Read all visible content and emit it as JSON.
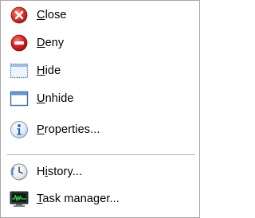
{
  "menu": {
    "items": [
      {
        "id": "close",
        "label": "Close",
        "mnemonic_index": 0,
        "icon": "close-icon"
      },
      {
        "id": "deny",
        "label": "Deny",
        "mnemonic_index": 0,
        "icon": "deny-icon"
      },
      {
        "id": "hide",
        "label": "Hide",
        "mnemonic_index": 0,
        "icon": "hide-window-icon"
      },
      {
        "id": "unhide",
        "label": "Unhide",
        "mnemonic_index": 0,
        "icon": "unhide-window-icon"
      },
      {
        "id": "properties",
        "label": "Properties...",
        "mnemonic_index": 0,
        "icon": "info-icon"
      },
      {
        "id": "history",
        "label": "History...",
        "mnemonic_index": 1,
        "icon": "clock-icon"
      },
      {
        "id": "task-manager",
        "label": "Task manager...",
        "mnemonic_index": 0,
        "icon": "monitor-graph-icon"
      }
    ]
  },
  "colors": {
    "close_red": "#d9342b",
    "deny_red": "#d92020",
    "window_blue": "#4a7fc1",
    "info_blue": "#2a66b8",
    "monitor_green": "#2ecc40",
    "separator": "#b5b5b5"
  }
}
